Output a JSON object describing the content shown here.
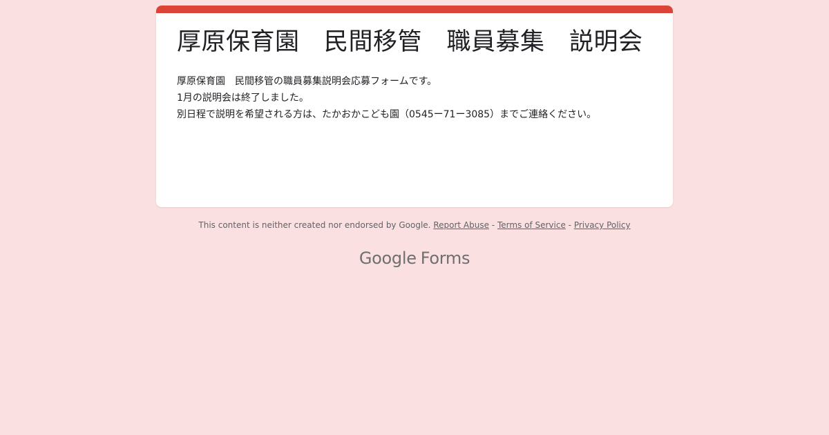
{
  "colors": {
    "background": "#fae0e0",
    "accent": "#db4437",
    "card": "#ffffff"
  },
  "form": {
    "title": "厚原保育園　民間移管　職員募集　説明会",
    "description": [
      "厚原保育園　民間移管の職員募集説明会応募フォームです。",
      "1月の説明会は終了しました。",
      "別日程で説明を希望される方は、たかおかこども園（0545ー71ー3085）までご連絡ください。"
    ]
  },
  "footer": {
    "disclaimer": "This content is neither created nor endorsed by Google.",
    "report_abuse": "Report Abuse",
    "terms": "Terms of Service",
    "privacy": "Privacy Policy",
    "separator": " - "
  },
  "brand": {
    "google": "Google",
    "forms": "Forms"
  }
}
